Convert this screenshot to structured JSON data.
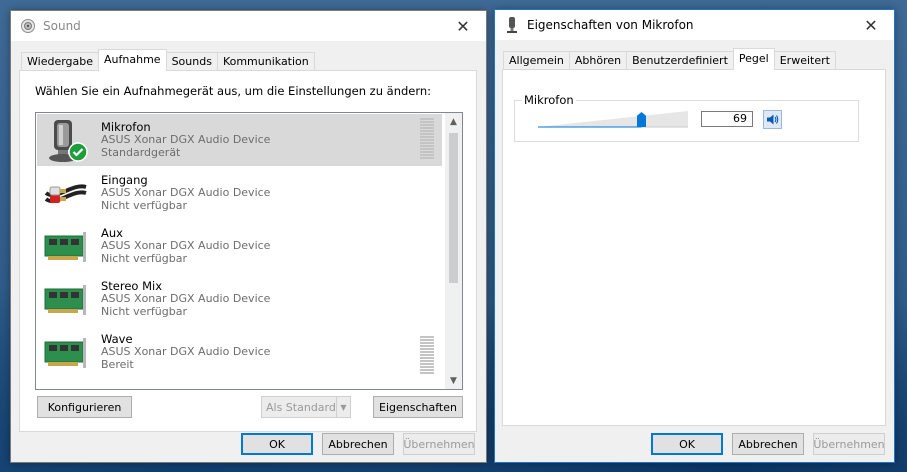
{
  "sound": {
    "title": "Sound",
    "tabs": [
      "Wiedergabe",
      "Aufnahme",
      "Sounds",
      "Kommunikation"
    ],
    "selected_tab": "Aufnahme",
    "instruction": "Wählen Sie ein Aufnahmegerät aus, um die Einstellungen zu ändern:",
    "devices": [
      {
        "name": "Mikrofon",
        "desc": "ASUS Xonar DGX Audio Device",
        "status": "Standardgerät",
        "icon": "microphone-icon",
        "selected": true,
        "default": true
      },
      {
        "name": "Eingang",
        "desc": "ASUS Xonar DGX Audio Device",
        "status": "Nicht verfügbar",
        "icon": "cable-plug-icon"
      },
      {
        "name": "Aux",
        "desc": "ASUS Xonar DGX Audio Device",
        "status": "Nicht verfügbar",
        "icon": "soundcard-icon"
      },
      {
        "name": "Stereo Mix",
        "desc": "ASUS Xonar DGX Audio Device",
        "status": "Nicht verfügbar",
        "icon": "soundcard-icon"
      },
      {
        "name": "Wave",
        "desc": "ASUS Xonar DGX Audio Device",
        "status": "Bereit",
        "icon": "soundcard-icon"
      }
    ],
    "buttons": {
      "configure": "Konfigurieren",
      "set_default": "Als Standard",
      "properties": "Eigenschaften",
      "ok": "OK",
      "cancel": "Abbrechen",
      "apply": "Übernehmen"
    }
  },
  "mic": {
    "title": "Eigenschaften von Mikrofon",
    "tabs": [
      "Allgemein",
      "Abhören",
      "Benutzerdefiniert",
      "Pegel",
      "Erweitert"
    ],
    "selected_tab": "Pegel",
    "group_label": "Mikrofon",
    "level_value": "69",
    "level_fraction": 0.69,
    "buttons": {
      "ok": "OK",
      "cancel": "Abbrechen",
      "apply": "Übernehmen"
    }
  },
  "colors": {
    "accent": "#0078d7",
    "default_check": "#1e9e3a"
  }
}
